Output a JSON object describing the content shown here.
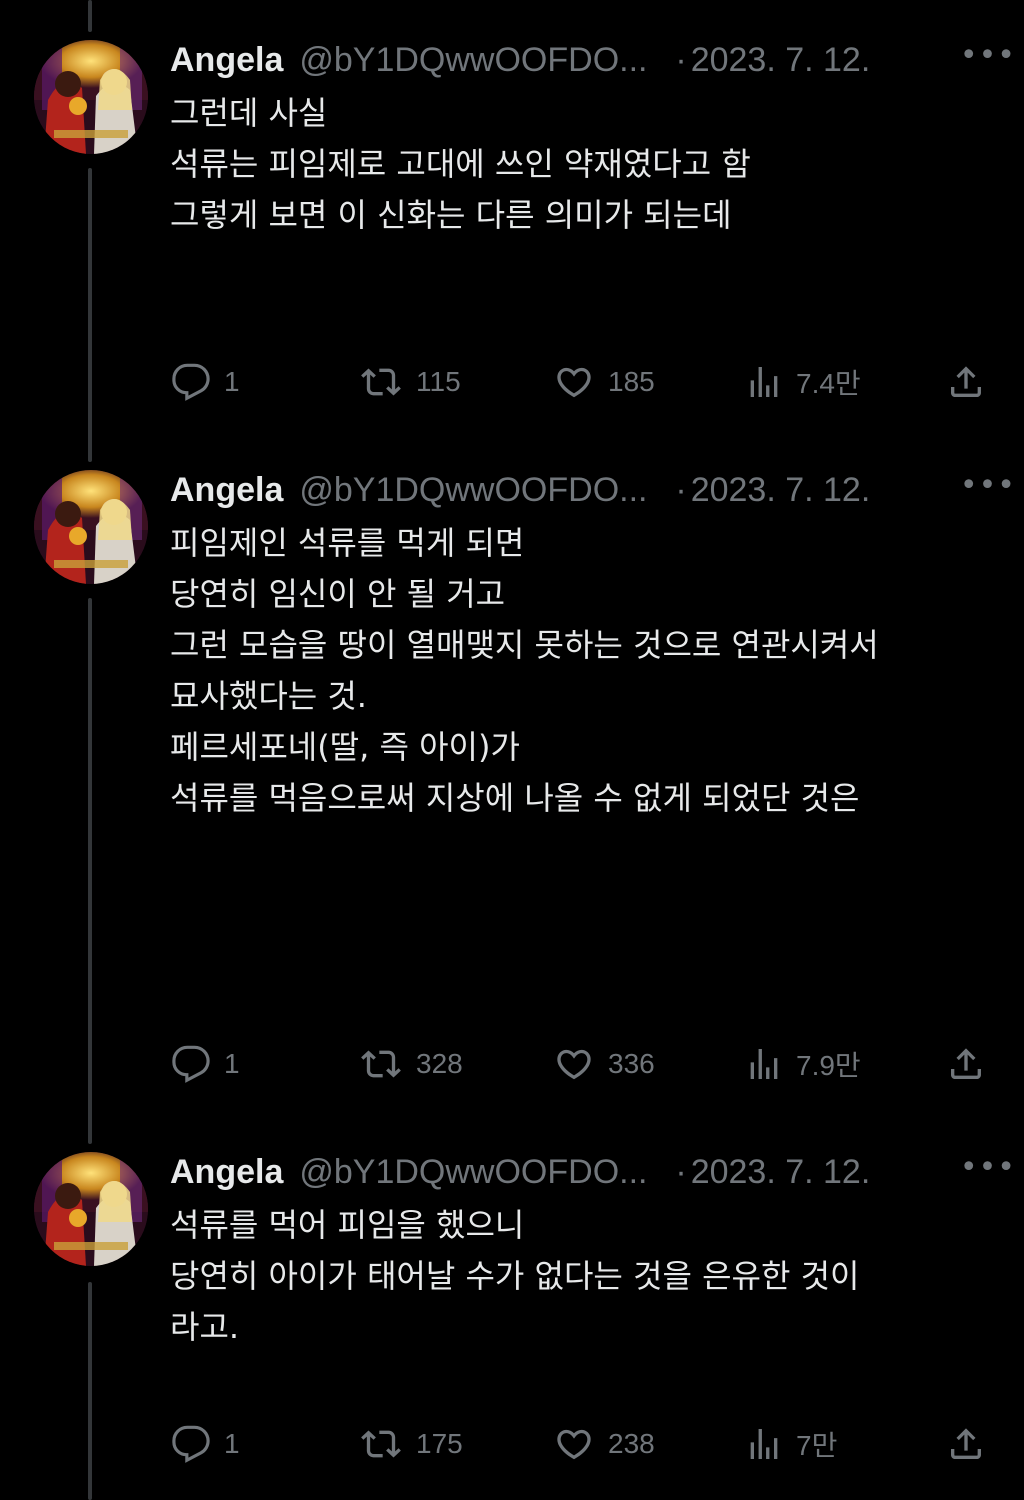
{
  "colors": {
    "background": "#000000",
    "text": "#e7e9ea",
    "secondary": "#71767b",
    "thread_line": "#333639"
  },
  "tweets": [
    {
      "name": "Angela",
      "handle": "@bY1DQwwOOFDO...",
      "separator": "·",
      "date": "2023. 7. 12.",
      "more_icon": "more-icon",
      "lines": [
        "그런데 사실",
        "",
        "석류는 피임제로 고대에 쓰인 약재였다고 함",
        "",
        "그렇게 보면 이 신화는 다른 의미가 되는데"
      ],
      "replies": "1",
      "retweets": "115",
      "likes": "185",
      "views": "7.4만"
    },
    {
      "name": "Angela",
      "handle": "@bY1DQwwOOFDO...",
      "separator": "·",
      "date": "2023. 7. 12.",
      "more_icon": "more-icon",
      "lines": [
        "피임제인 석류를 먹게 되면",
        "",
        "당연히 임신이 안 될 거고",
        "",
        "그런 모습을 땅이 열매맺지 못하는 것으로 연관시켜서",
        "묘사했다는 것.",
        "",
        "페르세포네(딸, 즉 아이)가",
        "",
        "석류를 먹음으로써 지상에 나올 수 없게 되었단 것은"
      ],
      "replies": "1",
      "retweets": "328",
      "likes": "336",
      "views": "7.9만"
    },
    {
      "name": "Angela",
      "handle": "@bY1DQwwOOFDO...",
      "separator": "·",
      "date": "2023. 7. 12.",
      "more_icon": "more-icon",
      "lines": [
        "석류를 먹어 피임을 했으니",
        "",
        "당연히 아이가 태어날 수가 없다는 것을 은유한 것이",
        "라고."
      ],
      "replies": "1",
      "retweets": "175",
      "likes": "238",
      "views": "7만"
    }
  ]
}
